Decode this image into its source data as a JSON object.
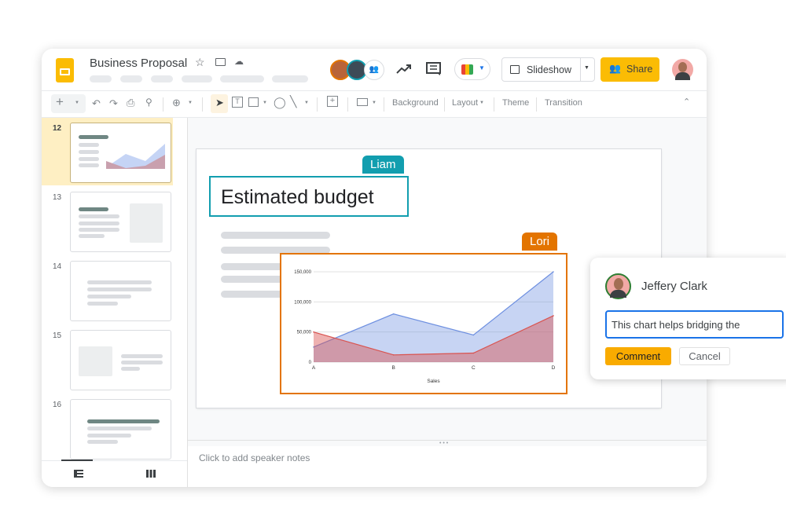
{
  "document": {
    "title": "Business Proposal"
  },
  "header": {
    "slideshow_label": "Slideshow",
    "share_label": "Share",
    "accent": "#fbbc04"
  },
  "toolbar": {
    "background": "Background",
    "layout": "Layout",
    "theme": "Theme",
    "transition": "Transition"
  },
  "slides": [
    {
      "number": "12"
    },
    {
      "number": "13"
    },
    {
      "number": "14"
    },
    {
      "number": "15"
    },
    {
      "number": "16"
    }
  ],
  "slide": {
    "title": "Estimated budget",
    "collaborators": [
      {
        "name": "Liam",
        "color": "#129eaf"
      },
      {
        "name": "Lori",
        "color": "#e37400"
      }
    ]
  },
  "chart_data": {
    "type": "area",
    "categories": [
      "A",
      "B",
      "C",
      "D"
    ],
    "xlabel": "Sales",
    "ylabel": "",
    "ylim": [
      0,
      150000
    ],
    "yticks": [
      "0",
      "50,000",
      "100,000",
      "150,000"
    ],
    "grid": true,
    "series": [
      {
        "values": [
          25000,
          80000,
          45000,
          150000
        ],
        "color": "#6d8fe0"
      },
      {
        "values": [
          50000,
          12000,
          15000,
          77000
        ],
        "color": "#d9534f"
      }
    ]
  },
  "comment": {
    "author": "Jeffery Clark",
    "input_value": "This chart helps bridging the",
    "comment_label": "Comment",
    "cancel_label": "Cancel"
  },
  "notes": {
    "placeholder": "Click to add speaker notes"
  }
}
